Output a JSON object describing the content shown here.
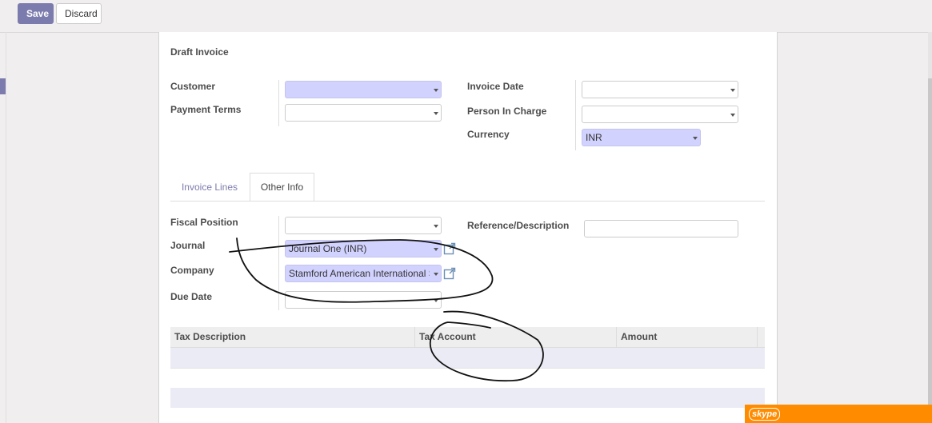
{
  "toolbar": {
    "save_label": "Save",
    "discard_label": "Discard"
  },
  "form": {
    "title": "Draft Invoice",
    "customer": {
      "label": "Customer",
      "value": ""
    },
    "payment_terms": {
      "label": "Payment Terms",
      "value": ""
    },
    "invoice_date": {
      "label": "Invoice Date",
      "value": ""
    },
    "person_in_charge": {
      "label": "Person In Charge",
      "value": ""
    },
    "currency": {
      "label": "Currency",
      "value": "INR"
    }
  },
  "tabs": [
    {
      "label": "Invoice Lines",
      "active": false
    },
    {
      "label": "Other Info",
      "active": true
    }
  ],
  "other_info": {
    "fiscal_position": {
      "label": "Fiscal Position",
      "value": ""
    },
    "journal": {
      "label": "Journal",
      "value": "Journal One (INR)"
    },
    "company": {
      "label": "Company",
      "value": "Stamford American International S"
    },
    "due_date": {
      "label": "Due Date",
      "value": ""
    },
    "reference": {
      "label": "Reference/Description",
      "value": ""
    }
  },
  "tax_table": {
    "columns": [
      "Tax Description",
      "Tax Account",
      "Amount"
    ],
    "rows": [
      [],
      [],
      []
    ]
  },
  "skype": {
    "logo": "skype"
  },
  "icons": {
    "external_link": "external-link-icon",
    "dropdown": "chevron-down-icon"
  },
  "colors": {
    "primary": "#7c7bad",
    "required_field": "#d2d2ff",
    "skype_bar": "#ff8c00"
  }
}
